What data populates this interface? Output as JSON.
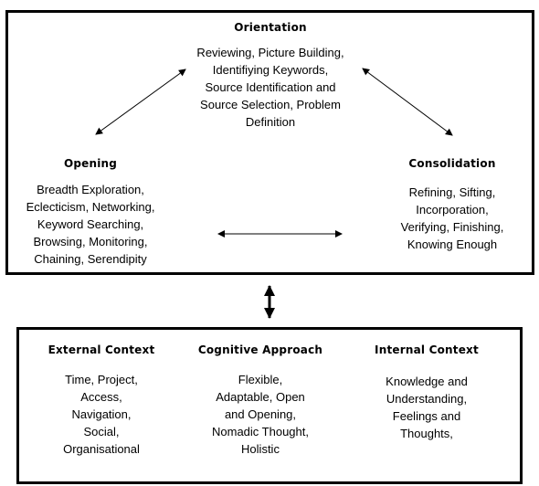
{
  "diagram": {
    "stages": {
      "orientation": {
        "title": "Orientation",
        "lines": [
          "Reviewing, Picture Building,",
          "Identifiying Keywords,",
          "Source Identification and",
          "Source Selection, Problem",
          "Definition"
        ]
      },
      "opening": {
        "title": "Opening",
        "lines": [
          "Breadth Exploration,",
          "Eclecticism, Networking,",
          "Keyword Searching,",
          "Browsing, Monitoring,",
          "Chaining, Serendipity"
        ]
      },
      "consolidation": {
        "title": "Consolidation",
        "lines": [
          "Refining, Sifting,",
          "Incorporation,",
          "Verifying, Finishing,",
          "Knowing Enough"
        ]
      }
    },
    "contexts": {
      "external": {
        "title": "External Context",
        "lines": [
          "Time, Project,",
          "Access,",
          "Navigation,",
          "Social,",
          "Organisational"
        ]
      },
      "cognitive": {
        "title": "Cognitive Approach",
        "lines": [
          "Flexible,",
          "Adaptable, Open",
          "and Opening,",
          "Nomadic Thought,",
          "Holistic"
        ]
      },
      "internal": {
        "title": "Internal Context",
        "lines": [
          "Knowledge and",
          "Understanding,",
          "Feelings and",
          "Thoughts,"
        ]
      }
    },
    "connections": [
      {
        "from": "opening",
        "to": "orientation",
        "type": "bidirectional"
      },
      {
        "from": "orientation",
        "to": "consolidation",
        "type": "bidirectional"
      },
      {
        "from": "opening",
        "to": "consolidation",
        "type": "bidirectional"
      },
      {
        "from": "stages-box",
        "to": "contexts-box",
        "type": "bidirectional"
      }
    ],
    "colors": {
      "line": "#000000",
      "background": "#ffffff",
      "text": "#000000"
    }
  }
}
